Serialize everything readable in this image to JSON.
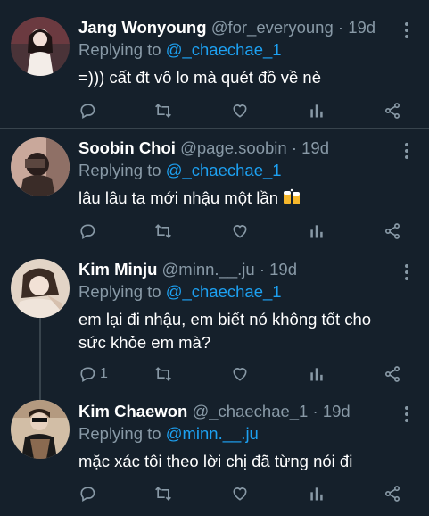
{
  "tweets": [
    {
      "name": "Jang Wonyoung",
      "handle": "@for_everyoung",
      "dot": "·",
      "time": "19d",
      "replying_prefix": "Replying to ",
      "replying_to": "@_chaechae_1",
      "text": "=))) cất đt vô lo mà quét đồ về nè",
      "reply_count": "",
      "avatar_colors": [
        "#3a2a2e",
        "#e9d6cf",
        "#2b1f1e"
      ]
    },
    {
      "name": "Soobin Choi",
      "handle": "@page.soobin",
      "dot": "·",
      "time": "19d",
      "replying_prefix": "Replying to ",
      "replying_to": "@_chaechae_1",
      "text": "lâu lâu ta mới nhậu một lần",
      "reply_count": "",
      "avatar_colors": [
        "#c9a89b",
        "#7a5f57",
        "#2a1e1c"
      ]
    },
    {
      "name": "Kim Minju",
      "handle": "@minn.__.ju",
      "dot": "·",
      "time": "19d",
      "replying_prefix": "Replying to ",
      "replying_to": "@_chaechae_1",
      "text": "em lại đi nhậu, em biết nó không tốt cho sức khỏe em mà?",
      "reply_count": "1",
      "avatar_colors": [
        "#d8c8b8",
        "#3b2c24",
        "#efe4da"
      ]
    },
    {
      "name": "Kim Chaewon",
      "handle": "@_chaechae_1",
      "dot": "·",
      "time": "19d",
      "replying_prefix": "Replying to ",
      "replying_to": "@minn.__.ju",
      "text": "mặc xác tôi theo lời chị đã từng nói đi",
      "reply_count": "",
      "avatar_colors": [
        "#c9b49b",
        "#1a1a1a",
        "#8a6a50"
      ]
    }
  ],
  "icons": {
    "reply": "reply-icon",
    "retweet": "retweet-icon",
    "like": "heart-icon",
    "analytics": "analytics-icon",
    "share": "share-icon",
    "more": "more-icon",
    "emoji": "beer-mugs-emoji"
  },
  "colors": {
    "background": "#15202b",
    "divider": "#38444d",
    "secondary_text": "#8899a6",
    "accent": "#1da1f2"
  }
}
